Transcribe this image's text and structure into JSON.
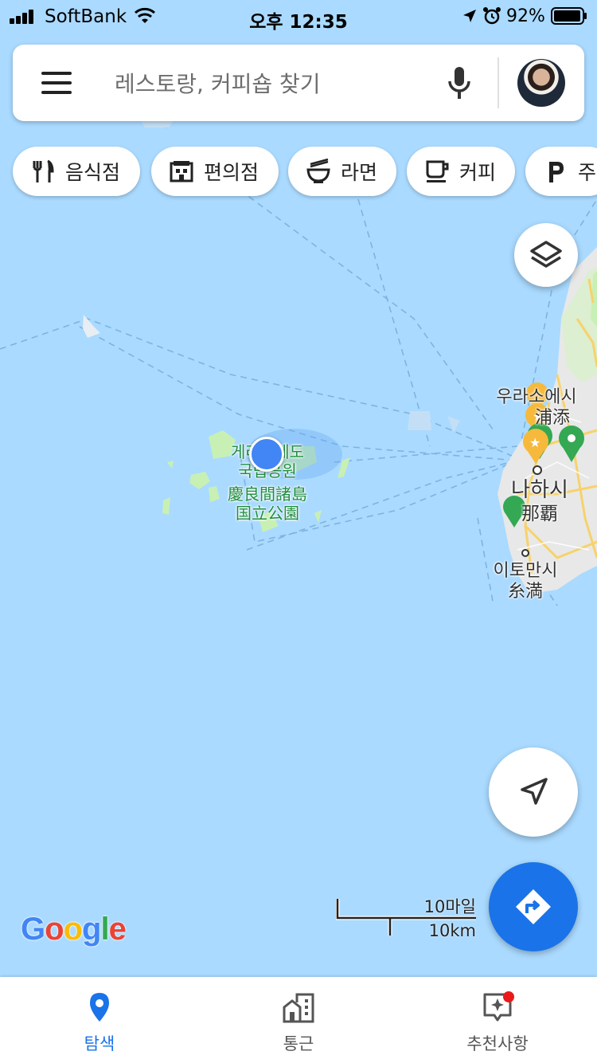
{
  "status_bar": {
    "carrier": "SoftBank",
    "time": "오후 12:35",
    "battery_percent": "92%"
  },
  "search": {
    "placeholder": "레스토랑, 커피숍 찾기"
  },
  "chips": [
    {
      "label": "음식점",
      "icon": "restaurant-icon"
    },
    {
      "label": "편의점",
      "icon": "convenience-store-icon"
    },
    {
      "label": "라면",
      "icon": "ramen-icon"
    },
    {
      "label": "커피",
      "icon": "coffee-icon"
    },
    {
      "label": "주차",
      "icon": "parking-icon"
    }
  ],
  "map": {
    "park_label_ko_1": "게라마제도",
    "park_label_ko_2": "국립공원",
    "park_label_ja_1": "慶良間諸島",
    "park_label_ja_2": "国立公園",
    "city_urasoe_ko": "우라소에시",
    "city_urasoe_ja": "浦添",
    "city_naha_ko": "나하시",
    "city_naha_ja": "那覇",
    "city_itoman_ko": "이토만시",
    "city_itoman_ja": "糸満",
    "water_color": "#aadaff",
    "land_color": "#e8e8e8",
    "park_color": "#c8f0b4"
  },
  "scale": {
    "miles": "10마일",
    "km": "10km"
  },
  "logo": {
    "letters": [
      "G",
      "o",
      "o",
      "g",
      "l",
      "e"
    ],
    "colors": [
      "#4285f4",
      "#ea4335",
      "#fbbc05",
      "#4285f4",
      "#34a853",
      "#ea4335"
    ]
  },
  "bottom_nav": {
    "explore": "탐색",
    "commute": "통근",
    "for_you": "추천사항"
  },
  "colors": {
    "accent": "#1a73e8",
    "notification": "#ea1a1a"
  }
}
